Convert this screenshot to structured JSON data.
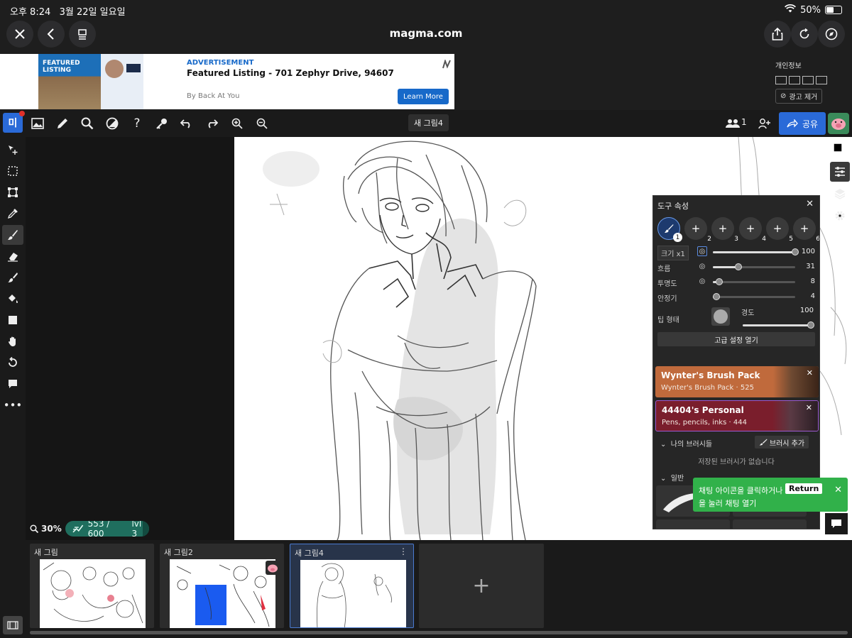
{
  "status_bar": {
    "time": "오후 8:24",
    "date": "3월 22일 일요일",
    "battery": "50%",
    "battery_level": 0.5
  },
  "browser": {
    "url": "magma.com"
  },
  "ad": {
    "thumb_text": "FEATURED LISTING",
    "tag": "ADVERTISEMENT",
    "title": "Featured Listing - 701 Zephyr Drive, 94607",
    "by": "By Back At You",
    "cta": "Learn More",
    "privacy_label": "개인정보",
    "remove_label": "광고 제거"
  },
  "toolbar": {
    "logo": "미",
    "document_title": "새 그림4",
    "users_count": "1",
    "share_label": "공유"
  },
  "canvas": {
    "zoom": "30%",
    "xp": "553 / 600",
    "level": "lvl 3",
    "xp_progress": 0.92
  },
  "tool_panel": {
    "title": "도구 속성",
    "slots": [
      "1",
      "2",
      "3",
      "4",
      "5",
      "6"
    ],
    "size_label": "크기 x1",
    "size_value": "100",
    "size_level": 1.0,
    "flow_label": "흐름",
    "flow_value": "31",
    "flow_level": 0.31,
    "opacity_label": "투명도",
    "opacity_value": "8",
    "opacity_level": 0.08,
    "stabilizer_label": "안정기",
    "stabilizer_value": "4",
    "stabilizer_level": 0.04,
    "tip_shape_label": "팁 형태",
    "hardness_label": "경도",
    "hardness_value": "100",
    "hardness_level": 1.0,
    "advanced_label": "고급 설정 열기",
    "packs": [
      {
        "title": "Wynter's Brush Pack",
        "subtitle": "Wynter's Brush Pack · 525",
        "color": "#c06a3c"
      },
      {
        "title": "44404's Personal",
        "subtitle": "Pens, pencils, inks · 444",
        "color": "#7a1e2c"
      }
    ],
    "my_brushes_label": "나의 브러시들",
    "add_brush_label": "브러시 추가",
    "no_brushes_label": "저장된 브러시가 없습니다",
    "general_label": "일반"
  },
  "chat_tip": {
    "line1": "채팅 아이콘을 클릭하거나",
    "key": "Return",
    "line2": "을 눌러 채팅 열기"
  },
  "files": [
    {
      "name": "새 그림"
    },
    {
      "name": "새 그림2"
    },
    {
      "name": "새 그림4"
    }
  ],
  "colors": {
    "accent": "#2a6ad8",
    "toast": "#31b14a",
    "xp": "#1f6e5e"
  }
}
